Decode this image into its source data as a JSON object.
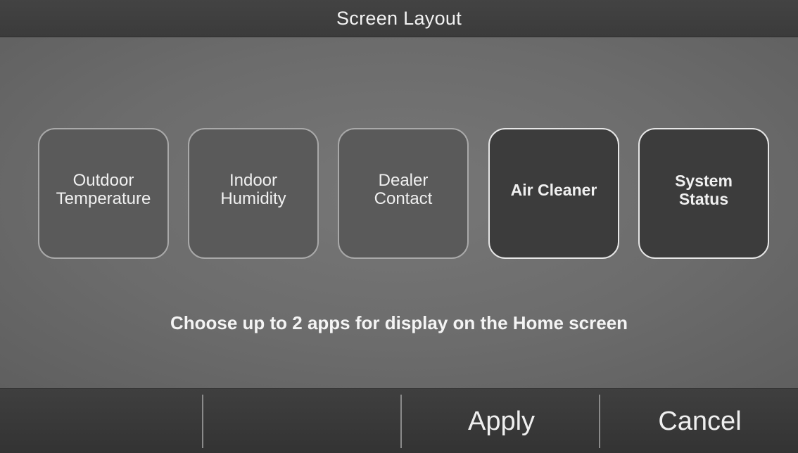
{
  "header": {
    "title": "Screen Layout"
  },
  "apps": [
    {
      "label": "Outdoor\nTemperature",
      "selected": false
    },
    {
      "label": "Indoor\nHumidity",
      "selected": false
    },
    {
      "label": "Dealer\nContact",
      "selected": false
    },
    {
      "label": "Air Cleaner",
      "selected": true
    },
    {
      "label": "System\nStatus",
      "selected": true
    }
  ],
  "instruction": "Choose up to 2 apps for display on the Home screen",
  "footer": {
    "slot1_label": "",
    "slot2_label": "",
    "apply_label": "Apply",
    "cancel_label": "Cancel"
  },
  "colors": {
    "selected_tile": "#3c3c3c",
    "unselected_tile": "#5a5a5a",
    "background": "#6b6b6b",
    "bar": "#3b3b3b"
  }
}
